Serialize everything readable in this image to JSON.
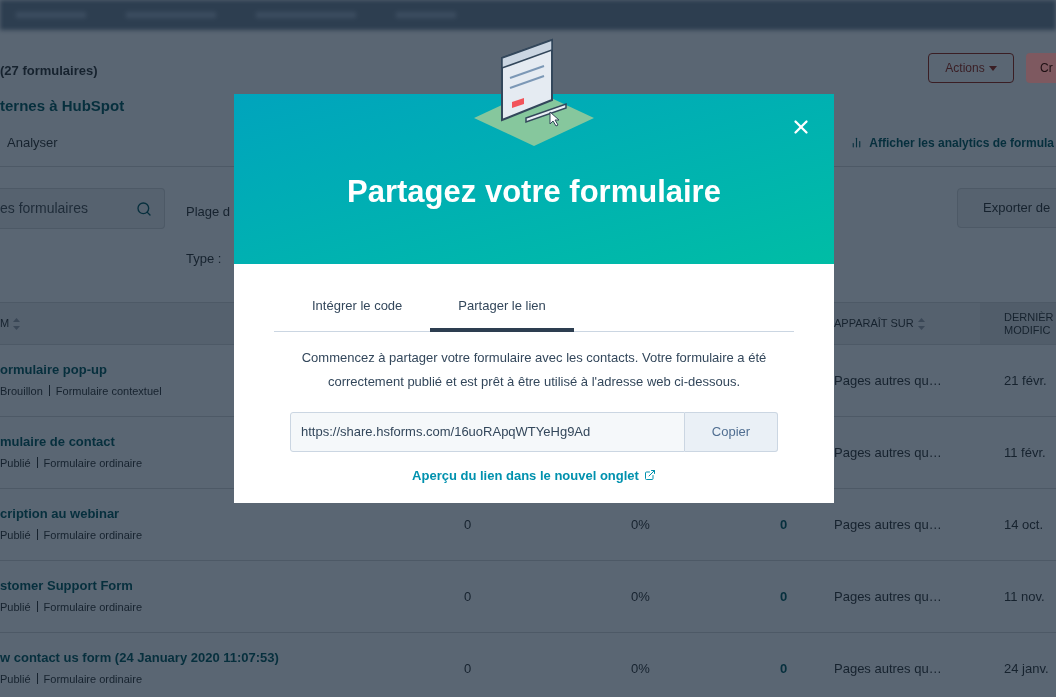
{
  "page": {
    "count": "(27 formulaires)",
    "link": "ternes à HubSpot",
    "tab": "Analyser",
    "analytics_link": "Afficher les analytics de formula",
    "actions_button": "Actions",
    "create_button": "Cr",
    "search": {
      "placeholder": "es formulaires"
    },
    "filters": [
      {
        "label": "Plage d"
      },
      {
        "label": "Type :"
      }
    ],
    "export_button": "Exporter de"
  },
  "table": {
    "columns": [
      {
        "label": "M",
        "sortable": true
      },
      {
        "label": "APPARAÎT SUR",
        "sortable": true
      },
      {
        "label": "DERNIÈR MODIFIC",
        "sortable": false
      }
    ],
    "rows": [
      {
        "name": "ormulaire pop-up",
        "status": "Brouillon",
        "type": "Formulaire contextuel",
        "appears_on": "Pages autres qu…",
        "date": "21 févr."
      },
      {
        "name": "mulaire de contact",
        "status": "Publié",
        "type": "Formulaire ordinaire",
        "appears_on": "Pages autres qu…",
        "date": "11 févr."
      },
      {
        "name": "cription au webinar",
        "status": "Publié",
        "type": "Formulaire ordinaire",
        "column_2": "0",
        "column_3": "0%",
        "column_4": "0",
        "appears_on": "Pages autres qu…",
        "date": "14 oct."
      },
      {
        "name": "stomer Support Form",
        "status": "Publié",
        "type": "Formulaire ordinaire",
        "column_2": "0",
        "column_3": "0%",
        "column_4": "0",
        "appears_on": "Pages autres qu…",
        "date": "11 nov."
      },
      {
        "name": "w contact us form (24 January 2020 11:07:53)",
        "status": "Publié",
        "type": "Formulaire ordinaire",
        "column_2": "0",
        "column_3": "0%",
        "column_4": "0",
        "appears_on": "Pages autres qu…",
        "date": "24 janv."
      }
    ]
  },
  "modal": {
    "title": "Partagez votre formulaire",
    "tabs": [
      {
        "label": "Intégrer le code",
        "selected": false
      },
      {
        "label": "Partager le lien",
        "selected": true
      }
    ],
    "description": "Commencez à partager votre formulaire avec les contacts. Votre formulaire a été correctement publié et est prêt à être utilisé à l'adresse web ci-dessous.",
    "url": "https://share.hsforms.com/16uoRApqWTYeHg9Ad",
    "copy_button": "Copier",
    "preview_link": "Aperçu du lien dans le nouvel onglet"
  }
}
